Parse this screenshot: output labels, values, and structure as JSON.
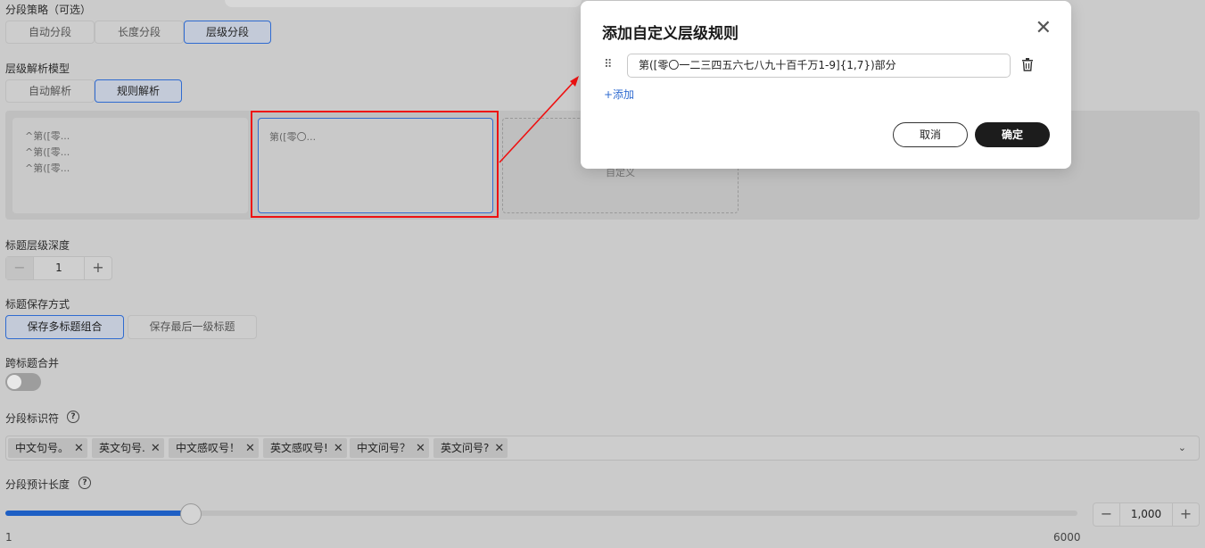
{
  "segment_strategy": {
    "label": "分段策略（可选）",
    "options": [
      "自动分段",
      "长度分段",
      "层级分段"
    ],
    "selected": "层级分段"
  },
  "parse_model": {
    "label": "层级解析模型",
    "options": [
      "自动解析",
      "规则解析"
    ],
    "selected": "规则解析"
  },
  "rule_cards": {
    "card1_lines": [
      "^第([零...",
      "^第([零...",
      "^第([零..."
    ],
    "card2_text": "第([零〇...",
    "card3_text": "自定义"
  },
  "heading_depth": {
    "label": "标题层级深度",
    "value": "1",
    "minus": "−",
    "plus": "+"
  },
  "heading_save": {
    "label": "标题保存方式",
    "options": [
      "保存多标题组合",
      "保存最后一级标题"
    ],
    "selected": "保存多标题组合"
  },
  "cross_merge": {
    "label": "跨标题合并",
    "enabled": false
  },
  "segment_markers": {
    "label": "分段标识符",
    "help": "?",
    "tags": [
      "中文句号。",
      "英文句号.",
      "中文感叹号！",
      "英文感叹号!",
      "中文问号？",
      "英文问号?"
    ],
    "remove_glyph": "✕",
    "chevron": "⌄"
  },
  "segment_length": {
    "label": "分段预计长度",
    "help": "?",
    "min_label": "1",
    "max_label": "6000",
    "value": "1,000",
    "value_numeric": 1000,
    "minus": "−",
    "plus": "+"
  },
  "dialog": {
    "title": "添加自定义层级规则",
    "close": "✕",
    "drag": "⠿",
    "rule_value": "第([零〇一二三四五六七八九十百千万1-9]{1,7})部分",
    "add_label": "+添加",
    "cancel_label": "取消",
    "confirm_label": "确定"
  },
  "colors": {
    "accent": "#2f6bd0",
    "highlight": "#e11111",
    "slider": "#1e5fc4"
  }
}
